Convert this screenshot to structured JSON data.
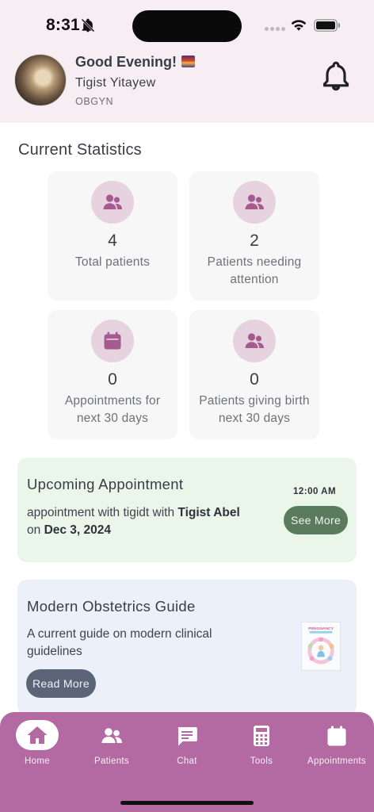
{
  "status_bar": {
    "time": "8:31"
  },
  "header": {
    "greeting": "Good Evening!",
    "doctor_name": "Tigist Yitayew",
    "doctor_role": "OBGYN"
  },
  "statistics": {
    "title": "Current Statistics",
    "cards": [
      {
        "value": "4",
        "label": "Total patients",
        "icon": "people-icon"
      },
      {
        "value": "2",
        "label": "Patients needing attention",
        "icon": "people-icon"
      },
      {
        "value": "0",
        "label": "Appointments for next 30 days",
        "icon": "calendar-icon"
      },
      {
        "value": "0",
        "label": "Patients giving birth next 30 days",
        "icon": "people-icon"
      }
    ]
  },
  "appointment": {
    "title": "Upcoming Appointment",
    "text_prefix": "appointment with tigidt with ",
    "patient": "Tigist Abel",
    "text_on": "on ",
    "date": "Dec 3, 2024",
    "time": "12:00 AM",
    "button": "See More"
  },
  "guide": {
    "title": "Modern Obstetrics Guide",
    "description": "A current guide on modern clinical guidelines",
    "button": "Read More",
    "thumbnail_text": "PREGNANCY"
  },
  "nav": {
    "items": [
      {
        "label": "Home",
        "icon": "home-icon"
      },
      {
        "label": "Patients",
        "icon": "people-icon"
      },
      {
        "label": "Chat",
        "icon": "chat-icon"
      },
      {
        "label": "Tools",
        "icon": "calculator-icon"
      },
      {
        "label": "Appointments",
        "icon": "calendar-icon"
      }
    ]
  },
  "colors": {
    "header_bg": "#f7eef3",
    "nav_bg": "#b36aa3",
    "stat_icon_bg": "#e7d2e0",
    "stat_icon_fg": "#a55b8f",
    "appointment_bg": "#e9f6e9",
    "see_more_bg": "#5a7c5c",
    "guide_bg": "#ecf0f8",
    "read_more_bg": "#5c6578"
  }
}
